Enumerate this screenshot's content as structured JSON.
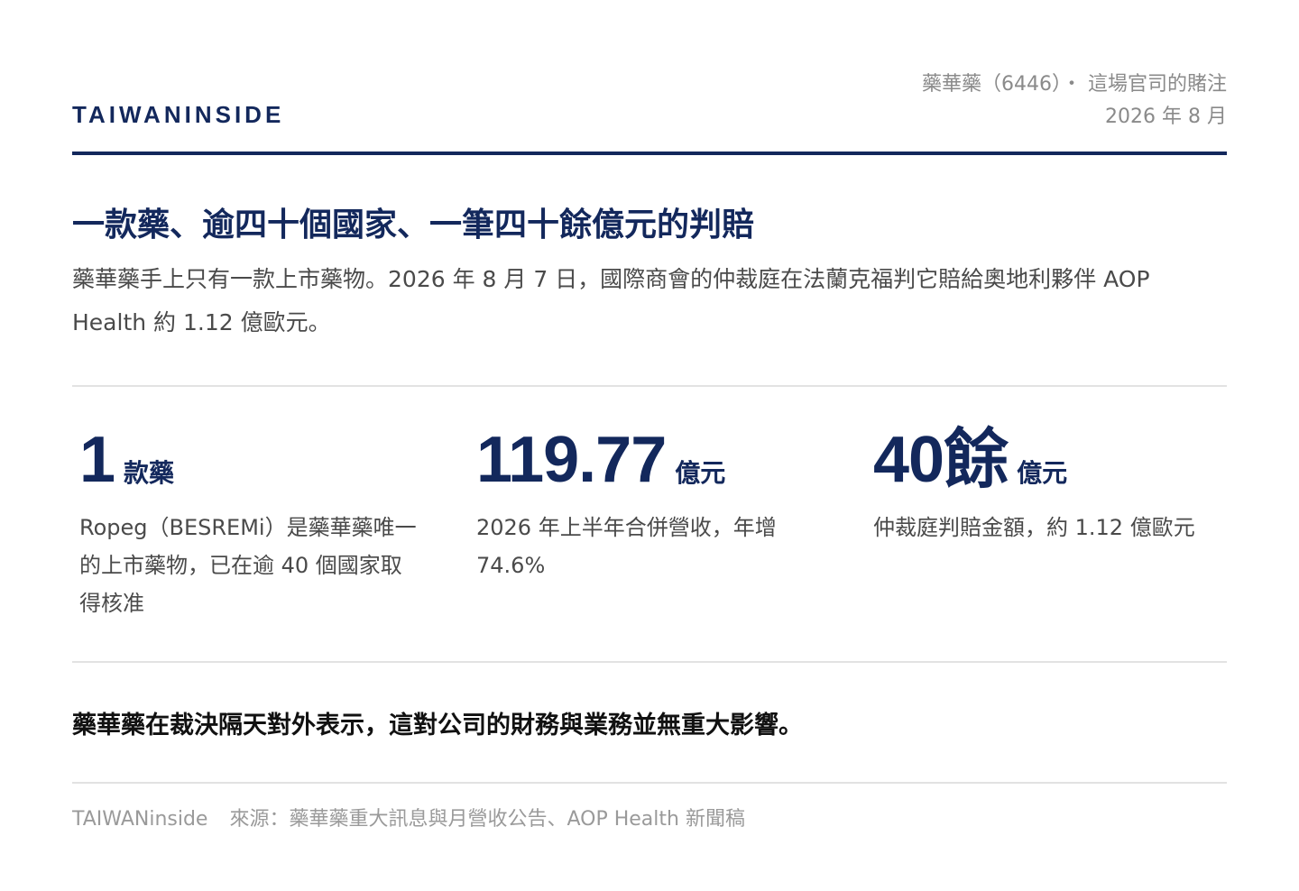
{
  "header": {
    "brand": "TAIWANINSIDE",
    "meta_line1": "藥華藥（6446）・ 這場官司的賭注",
    "meta_line2": "2026 年 8 月"
  },
  "headline": "一款藥、逾四十個國家、一筆四十餘億元的判賠",
  "lead": "藥華藥手上只有一款上市藥物。2026 年 8 月 7 日，國際商會的仲裁庭在法蘭克福判它賠給奧地利夥伴 AOP Health 約 1.12 億歐元。",
  "stats": [
    {
      "value": "1",
      "unit": "款藥",
      "desc": "Ropeg（BESREMi）是藥華藥唯一的上市藥物，已在逾 40 個國家取得核准"
    },
    {
      "value": "119.77",
      "unit": "億元",
      "desc": "2026 年上半年合併營收，年增 74.6%"
    },
    {
      "value": "40餘",
      "unit": "億元",
      "desc": "仲裁庭判賠金額，約 1.12 億歐元"
    }
  ],
  "conclusion": "藥華藥在裁決隔天對外表示，這對公司的財務與業務並無重大影響。",
  "footer": {
    "brand": "TAIWANinside",
    "source": "來源：藥華藥重大訊息與月營收公告、AOP Health 新聞稿"
  },
  "colors": {
    "accent": "#13285c",
    "body_text": "#4a4a4a",
    "muted_text": "#8a8a8a",
    "divider": "#e2e2e2"
  }
}
